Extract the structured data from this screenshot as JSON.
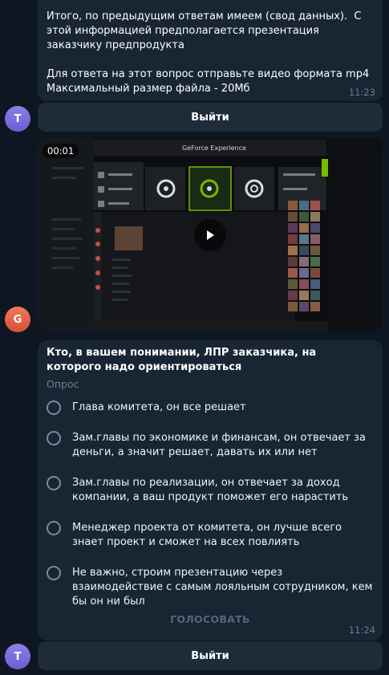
{
  "message1": {
    "text": "Итого, по предыдущим ответам имеем (свод данных).  С этой информацией предполагается презентация заказчику предпродукта\n\nДля ответа на этот вопрос отправьте видео формата mp4\nМаксимальный размер файла - 20Мб",
    "time": "11:23"
  },
  "avatars": {
    "first": "T",
    "video": "G",
    "last": "T"
  },
  "keyboard1": {
    "label": "Выйти"
  },
  "video": {
    "duration": "00:01",
    "app_title": "GeForce Experience"
  },
  "poll": {
    "question": "Кто, в вашем понимании, ЛПР заказчика, на которого надо ориентироваться",
    "type": "Опрос",
    "options": [
      "Глава комитета, он все решает",
      "Зам.главы по экономике и финансам, он  отвечает за деньги, а значит решает, давать их или нет",
      "Зам.главы по реализации, он отвечает за доход компании, а ваш продукт поможет его нарастить",
      "Менеджер проекта от комитета, он лучше всего знает проект и сможет на всех повлиять",
      "Не важно, строим презентацию через взаимодействие с самым лояльным сотрудником, кем бы он ни был"
    ],
    "vote_label": "ГОЛОСОВАТЬ",
    "time": "11:24"
  },
  "keyboard2": {
    "label": "Выйти"
  },
  "colors": {
    "background": "#0e1621",
    "bubble": "#182533",
    "keyboard_button": "#1e2c3a",
    "muted_text": "#6d7f8f",
    "avatar_t": "#7b6ce0",
    "avatar_g": "#e5654a"
  }
}
